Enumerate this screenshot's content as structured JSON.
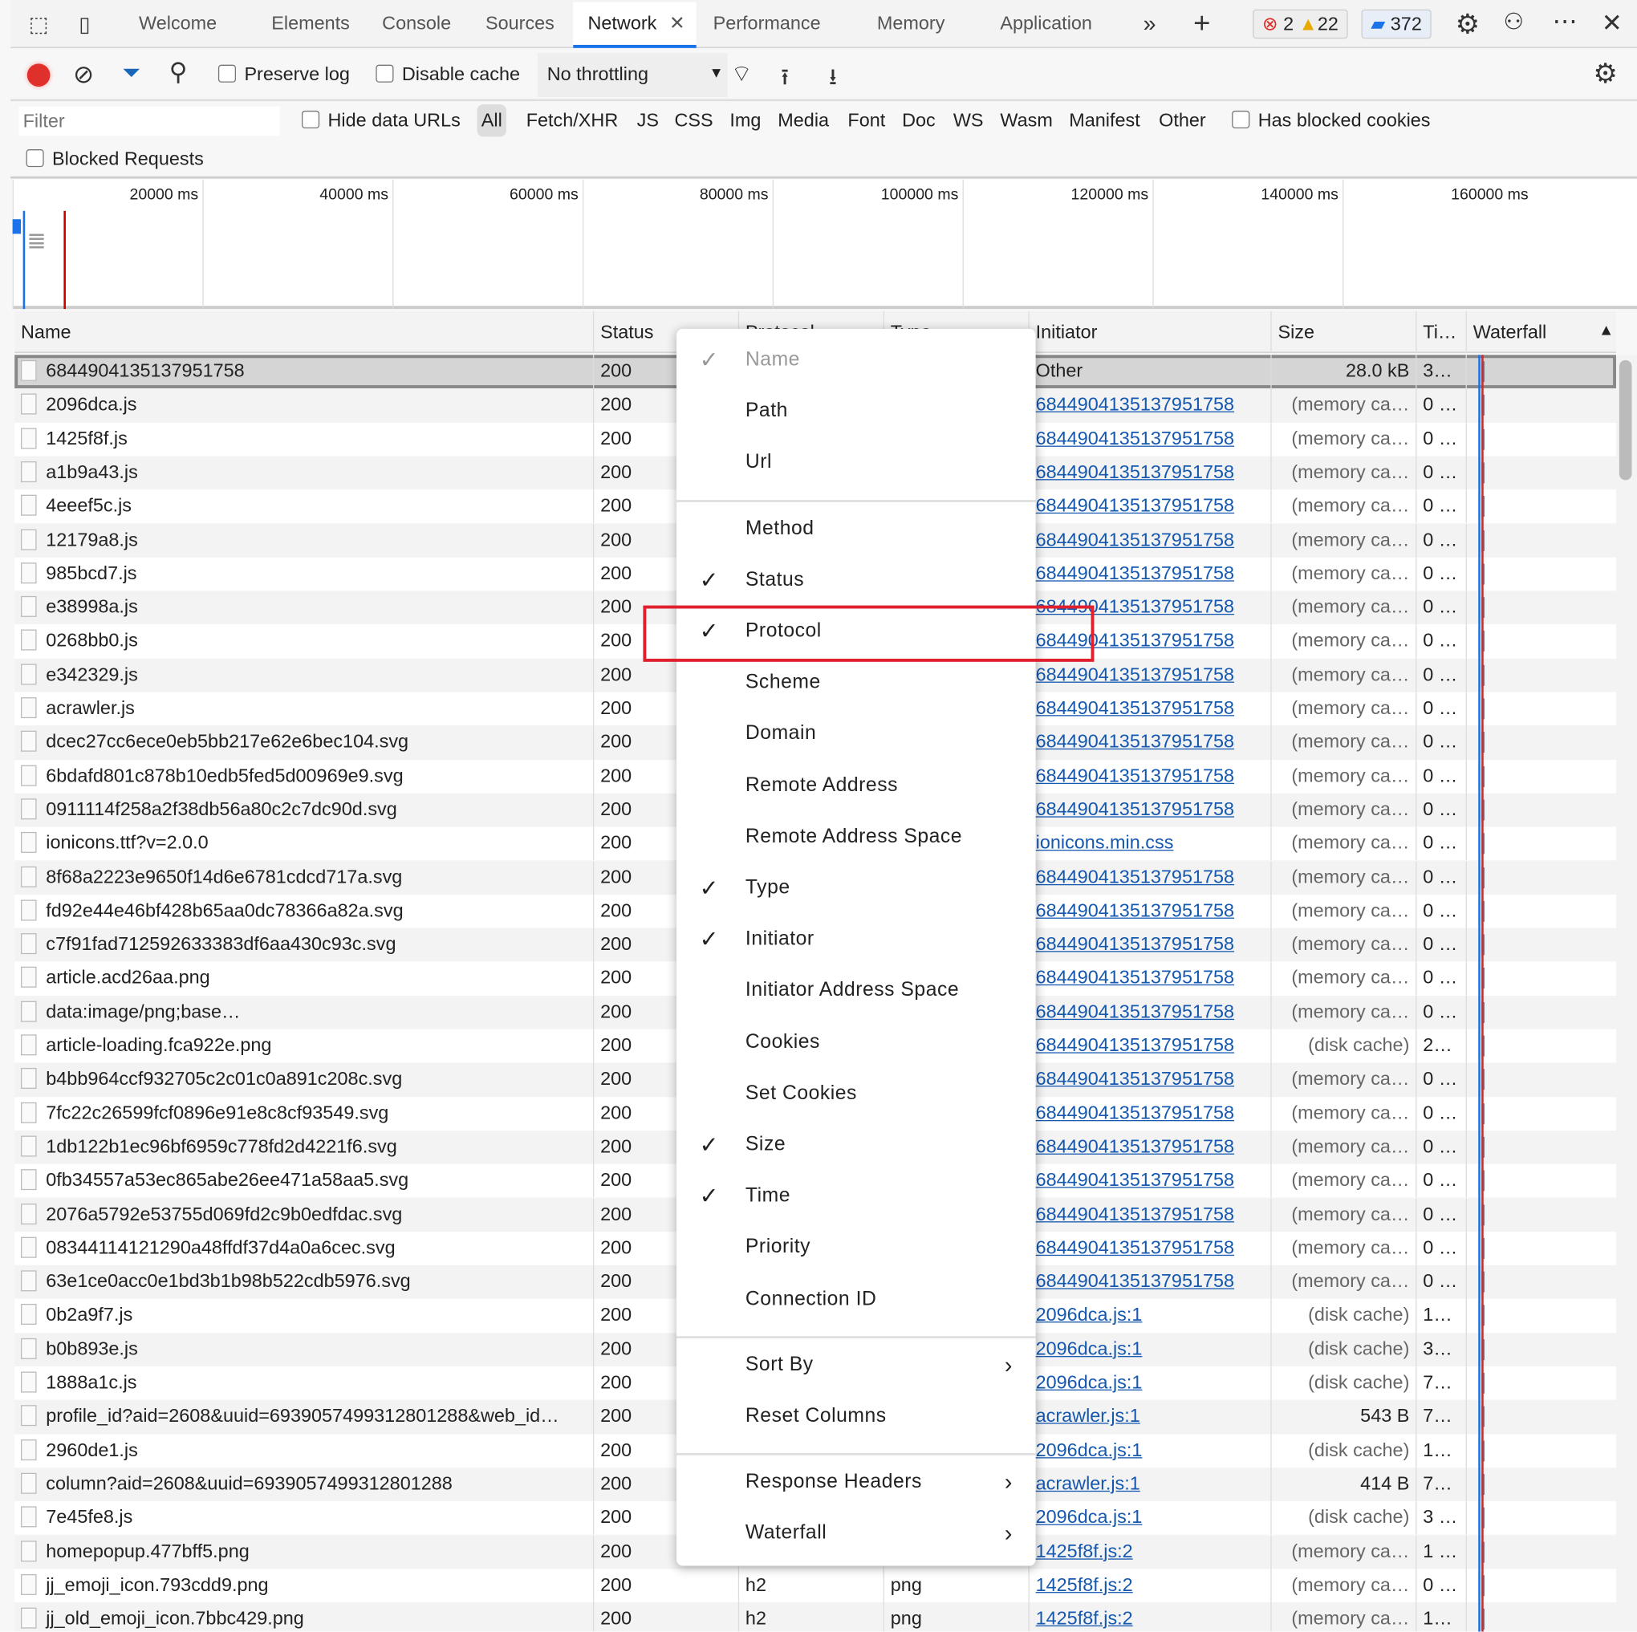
{
  "tabs": [
    "Welcome",
    "Elements",
    "Console",
    "Sources",
    "Network",
    "Performance",
    "Memory",
    "Application"
  ],
  "active_tab": "Network",
  "badges": {
    "errors": "2",
    "warnings": "22",
    "messages": "372"
  },
  "toolbar": {
    "preserve_log": "Preserve log",
    "disable_cache": "Disable cache",
    "throttling": "No throttling"
  },
  "filter": {
    "placeholder": "Filter",
    "hide_data_urls": "Hide data URLs",
    "types": [
      "All",
      "Fetch/XHR",
      "JS",
      "CSS",
      "Img",
      "Media",
      "Font",
      "Doc",
      "WS",
      "Wasm",
      "Manifest",
      "Other"
    ],
    "active_type": "All",
    "has_blocked_cookies": "Has blocked cookies",
    "blocked_requests": "Blocked Requests"
  },
  "overview_ticks": [
    "20000 ms",
    "40000 ms",
    "60000 ms",
    "80000 ms",
    "100000 ms",
    "120000 ms",
    "140000 ms",
    "160000 ms"
  ],
  "columns": {
    "name": "Name",
    "status": "Status",
    "protocol": "Protocol",
    "type": "Type",
    "initiator": "Initiator",
    "size": "Size",
    "time": "Ti…",
    "waterfall": "Waterfall"
  },
  "rows": [
    {
      "name": "6844904135137951758",
      "status": "200",
      "protocol": "",
      "type": "",
      "initiator": "Other",
      "size": "28.0 kB",
      "time": "3…"
    },
    {
      "name": "2096dca.js",
      "status": "200",
      "initiator": "6844904135137951758",
      "size": "(memory ca…",
      "time": "0 …"
    },
    {
      "name": "1425f8f.js",
      "status": "200",
      "initiator": "6844904135137951758",
      "size": "(memory ca…",
      "time": "0 …"
    },
    {
      "name": "a1b9a43.js",
      "status": "200",
      "initiator": "6844904135137951758",
      "size": "(memory ca…",
      "time": "0 …"
    },
    {
      "name": "4eeef5c.js",
      "status": "200",
      "initiator": "6844904135137951758",
      "size": "(memory ca…",
      "time": "0 …"
    },
    {
      "name": "12179a8.js",
      "status": "200",
      "initiator": "6844904135137951758",
      "size": "(memory ca…",
      "time": "0 …"
    },
    {
      "name": "985bcd7.js",
      "status": "200",
      "initiator": "6844904135137951758",
      "size": "(memory ca…",
      "time": "0 …"
    },
    {
      "name": "e38998a.js",
      "status": "200",
      "initiator": "6844904135137951758",
      "size": "(memory ca…",
      "time": "0 …"
    },
    {
      "name": "0268bb0.js",
      "status": "200",
      "initiator": "6844904135137951758",
      "size": "(memory ca…",
      "time": "0 …"
    },
    {
      "name": "e342329.js",
      "status": "200",
      "initiator": "6844904135137951758",
      "size": "(memory ca…",
      "time": "0 …"
    },
    {
      "name": "acrawler.js",
      "status": "200",
      "initiator": "6844904135137951758",
      "size": "(memory ca…",
      "time": "0 …"
    },
    {
      "name": "dcec27cc6ece0eb5bb217e62e6bec104.svg",
      "status": "200",
      "initiator": "6844904135137951758",
      "size": "(memory ca…",
      "time": "0 …"
    },
    {
      "name": "6bdafd801c878b10edb5fed5d00969e9.svg",
      "status": "200",
      "initiator": "6844904135137951758",
      "size": "(memory ca…",
      "time": "0 …"
    },
    {
      "name": "0911114f258a2f38db56a80c2c7dc90d.svg",
      "status": "200",
      "initiator": "6844904135137951758",
      "size": "(memory ca…",
      "time": "0 …"
    },
    {
      "name": "ionicons.ttf?v=2.0.0",
      "status": "200",
      "initiator": "ionicons.min.css",
      "size": "(memory ca…",
      "time": "0 …"
    },
    {
      "name": "8f68a2223e9650f14d6e6781cdcd717a.svg",
      "status": "200",
      "initiator": "6844904135137951758",
      "size": "(memory ca…",
      "time": "0 …"
    },
    {
      "name": "fd92e44e46bf428b65aa0dc78366a82a.svg",
      "status": "200",
      "initiator": "6844904135137951758",
      "size": "(memory ca…",
      "time": "0 …"
    },
    {
      "name": "c7f91fad712592633383df6aa430c93c.svg",
      "status": "200",
      "initiator": "6844904135137951758",
      "size": "(memory ca…",
      "time": "0 …"
    },
    {
      "name": "article.acd26aa.png",
      "status": "200",
      "initiator": "6844904135137951758",
      "size": "(memory ca…",
      "time": "0 …"
    },
    {
      "name": "data:image/png;base…",
      "status": "200",
      "initiator": "6844904135137951758",
      "size": "(memory ca…",
      "time": "0 …"
    },
    {
      "name": "article-loading.fca922e.png",
      "status": "200",
      "initiator": "6844904135137951758",
      "size": "(disk cache)",
      "time": "2…"
    },
    {
      "name": "b4bb964ccf932705c2c01c0a891c208c.svg",
      "status": "200",
      "initiator": "6844904135137951758",
      "size": "(memory ca…",
      "time": "0 …"
    },
    {
      "name": "7fc22c26599fcf0896e91e8c8cf93549.svg",
      "status": "200",
      "initiator": "6844904135137951758",
      "size": "(memory ca…",
      "time": "0 …"
    },
    {
      "name": "1db122b1ec96bf6959c778fd2d4221f6.svg",
      "status": "200",
      "initiator": "6844904135137951758",
      "size": "(memory ca…",
      "time": "0 …"
    },
    {
      "name": "0fb34557a53ec865abe26ee471a58aa5.svg",
      "status": "200",
      "initiator": "6844904135137951758",
      "size": "(memory ca…",
      "time": "0 …"
    },
    {
      "name": "2076a5792e53755d069fd2c9b0edfdac.svg",
      "status": "200",
      "initiator": "6844904135137951758",
      "size": "(memory ca…",
      "time": "0 …"
    },
    {
      "name": "08344114121290a48ffdf37d4a0a6cec.svg",
      "status": "200",
      "initiator": "6844904135137951758",
      "size": "(memory ca…",
      "time": "0 …"
    },
    {
      "name": "63e1ce0acc0e1bd3b1b98b522cdb5976.svg",
      "status": "200",
      "initiator": "6844904135137951758",
      "size": "(memory ca…",
      "time": "0 …"
    },
    {
      "name": "0b2a9f7.js",
      "status": "200",
      "initiator": "2096dca.js:1",
      "size": "(disk cache)",
      "time": "1…"
    },
    {
      "name": "b0b893e.js",
      "status": "200",
      "initiator": "2096dca.js:1",
      "size": "(disk cache)",
      "time": "3…"
    },
    {
      "name": "1888a1c.js",
      "status": "200",
      "initiator": "2096dca.js:1",
      "size": "(disk cache)",
      "time": "7…"
    },
    {
      "name": "profile_id?aid=2608&uuid=6939057499312801288&web_id…",
      "status": "200",
      "initiator": "acrawler.js:1",
      "size": "543 B",
      "time": "7…"
    },
    {
      "name": "2960de1.js",
      "status": "200",
      "initiator": "2096dca.js:1",
      "size": "(disk cache)",
      "time": "1…"
    },
    {
      "name": "column?aid=2608&uuid=6939057499312801288",
      "status": "200",
      "initiator": "acrawler.js:1",
      "size": "414 B",
      "time": "7…"
    },
    {
      "name": "7e45fe8.js",
      "status": "200",
      "initiator": "2096dca.js:1",
      "size": "(disk cache)",
      "time": "3 …"
    },
    {
      "name": "homepopup.477bff5.png",
      "status": "200",
      "initiator": "1425f8f.js:2",
      "size": "(memory ca…",
      "time": "1 …"
    },
    {
      "name": "jj_emoji_icon.793cdd9.png",
      "status": "200",
      "protocol": "h2",
      "type": "png",
      "initiator": "1425f8f.js:2",
      "size": "(memory ca…",
      "time": "0 …"
    },
    {
      "name": "jj_old_emoji_icon.7bbc429.png",
      "status": "200",
      "protocol": "h2",
      "type": "png",
      "initiator": "1425f8f.js:2",
      "size": "(memory ca…",
      "time": "1…"
    }
  ],
  "context_menu": {
    "items": [
      {
        "label": "Name",
        "checked": true,
        "disabled": true
      },
      {
        "label": "Path"
      },
      {
        "label": "Url"
      },
      {
        "sep": true
      },
      {
        "label": "Method"
      },
      {
        "label": "Status",
        "checked": true
      },
      {
        "label": "Protocol",
        "checked": true,
        "highlighted": true
      },
      {
        "label": "Scheme"
      },
      {
        "label": "Domain"
      },
      {
        "label": "Remote Address"
      },
      {
        "label": "Remote Address Space"
      },
      {
        "label": "Type",
        "checked": true
      },
      {
        "label": "Initiator",
        "checked": true
      },
      {
        "label": "Initiator Address Space"
      },
      {
        "label": "Cookies"
      },
      {
        "label": "Set Cookies"
      },
      {
        "label": "Size",
        "checked": true
      },
      {
        "label": "Time",
        "checked": true
      },
      {
        "label": "Priority"
      },
      {
        "label": "Connection ID"
      },
      {
        "sep": true
      },
      {
        "label": "Sort By",
        "submenu": true
      },
      {
        "label": "Reset Columns"
      },
      {
        "sep": true
      },
      {
        "label": "Response Headers",
        "submenu": true
      },
      {
        "label": "Waterfall",
        "submenu": true
      }
    ]
  },
  "colors": {
    "accent": "#1a73e8",
    "record": "#e0302c",
    "highlight_box": "#e0202c",
    "link": "#1558b0"
  }
}
